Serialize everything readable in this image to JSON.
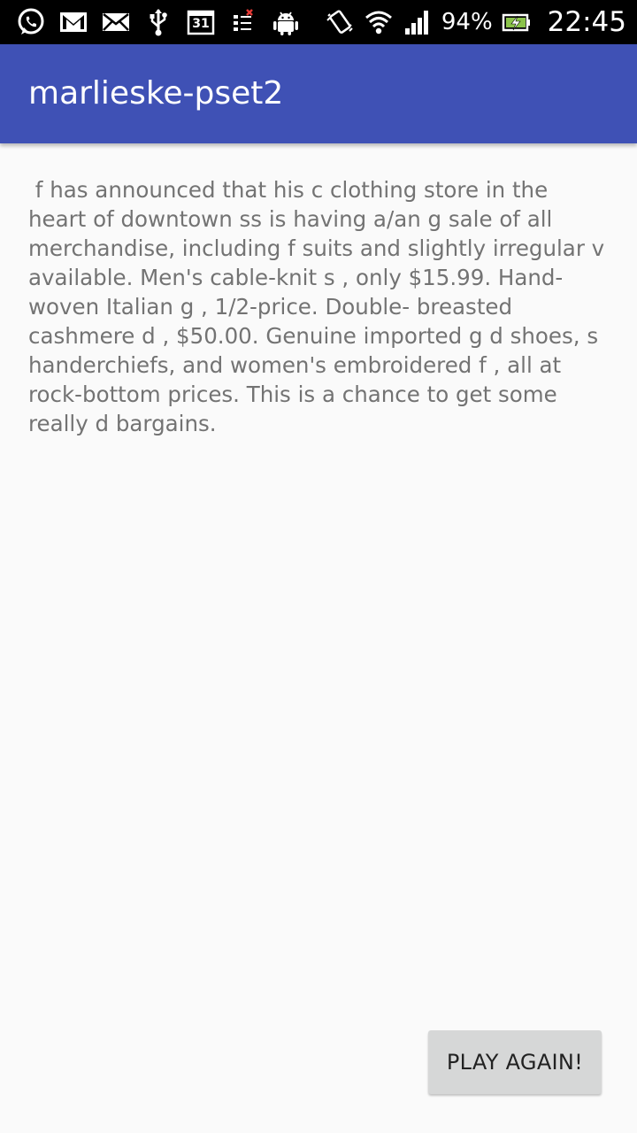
{
  "status_bar": {
    "icons_left": [
      "whatsapp-icon",
      "gmail-icon",
      "email-icon",
      "usb-icon",
      "calendar-icon",
      "notification-icon",
      "android-icon"
    ],
    "calendar_day": "31",
    "battery_percent": "94%",
    "time": "22:45",
    "signal_level": 0.8,
    "battery_level": 0.94
  },
  "app_bar": {
    "title": "marlieske-pset2",
    "color": "#3f51b5"
  },
  "story": {
    "text": " f has announced that his c clothing store in the heart of downtown ss is having a/an g sale of all merchandise, including f suits and slightly irregular v available. Men's cable-knit s , only $15.99. Hand-woven Italian g , 1/2-price. Double- breasted cashmere d , $50.00. Genuine imported g d shoes, s handerchiefs, and women's embroidered f , all at rock-bottom prices. This is a chance to get some really d bargains."
  },
  "play_again": {
    "label": "PLAY AGAIN!"
  }
}
